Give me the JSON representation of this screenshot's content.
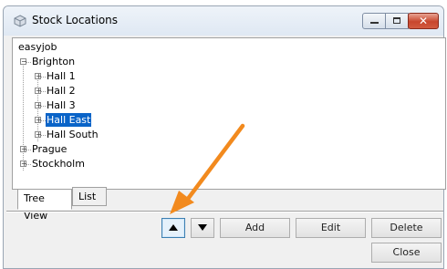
{
  "window": {
    "title": "Stock Locations",
    "close_glyph": "✕"
  },
  "tree": {
    "root": "easyjob",
    "nodes": [
      {
        "label": "Brighton",
        "expanded": true
      },
      {
        "label": "Hall 1"
      },
      {
        "label": "Hall 2"
      },
      {
        "label": "Hall 3"
      },
      {
        "label": "Hall East",
        "selected": true
      },
      {
        "label": "Hall South"
      },
      {
        "label": "Prague"
      },
      {
        "label": "Stockholm"
      }
    ]
  },
  "tabs": [
    {
      "label": "Tree View",
      "active": true
    },
    {
      "label": "List",
      "active": false
    }
  ],
  "buttons": {
    "add": "Add",
    "edit": "Edit",
    "delete": "Delete",
    "close": "Close"
  },
  "colors": {
    "selection": "#0a64c8",
    "annotation_arrow": "#f28a1e"
  },
  "icons": {
    "app": "cube-icon",
    "move_up": "triangle-up-icon",
    "move_down": "triangle-down-icon"
  }
}
